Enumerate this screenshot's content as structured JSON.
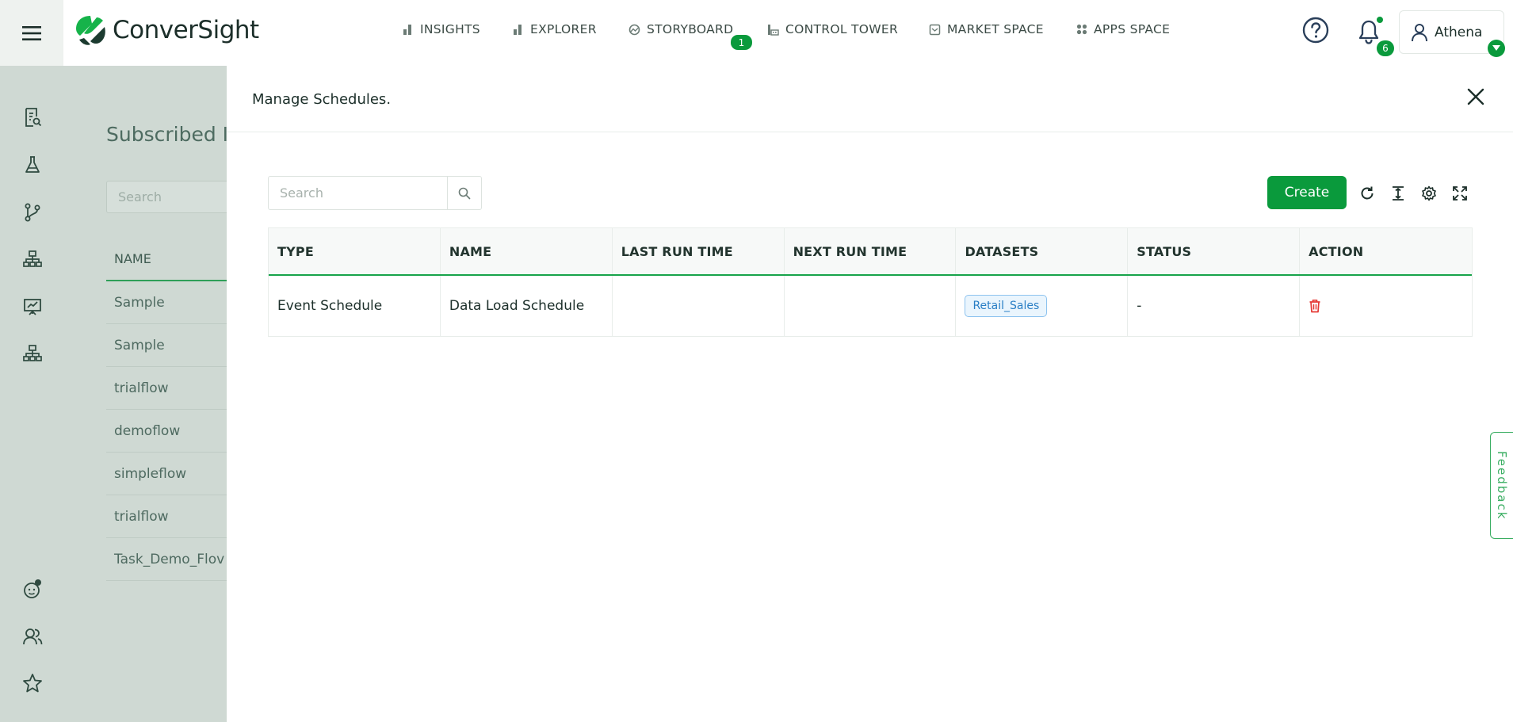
{
  "brand": {
    "name": "ConverSight"
  },
  "nav": [
    {
      "label": "INSIGHTS",
      "icon": "bar-chart-icon"
    },
    {
      "label": "EXPLORER",
      "icon": "bar-chart-icon"
    },
    {
      "label": "STORYBOARD",
      "icon": "storyboard-icon",
      "badge": "1"
    },
    {
      "label": "CONTROL TOWER",
      "icon": "control-tower-icon"
    },
    {
      "label": "MARKET SPACE",
      "icon": "market-icon"
    },
    {
      "label": "APPS SPACE",
      "icon": "apps-grid-icon"
    }
  ],
  "header": {
    "notification_count": "6",
    "user_name": "Athena"
  },
  "background_page": {
    "title": "Subscribed I",
    "search_placeholder": "Search",
    "column_header": "NAME",
    "rows": [
      "Sample",
      "Sample",
      "trialflow",
      "demoflow",
      "simpleflow",
      "trialflow",
      "Task_Demo_Flov"
    ]
  },
  "drawer": {
    "title": "Manage Schedules.",
    "search_placeholder": "Search",
    "create_label": "Create",
    "columns": [
      "TYPE",
      "NAME",
      "LAST RUN TIME",
      "NEXT RUN TIME",
      "DATASETS",
      "STATUS",
      "ACTION"
    ],
    "rows": [
      {
        "type": "Event Schedule",
        "name": "Data Load Schedule",
        "last_run": "",
        "next_run": "",
        "dataset": "Retail_Sales",
        "status": "-"
      }
    ]
  },
  "feedback_label": "Feedback",
  "colors": {
    "accent": "#0a9a3c",
    "rail": "#cfd9d3",
    "delete": "#e53935"
  }
}
